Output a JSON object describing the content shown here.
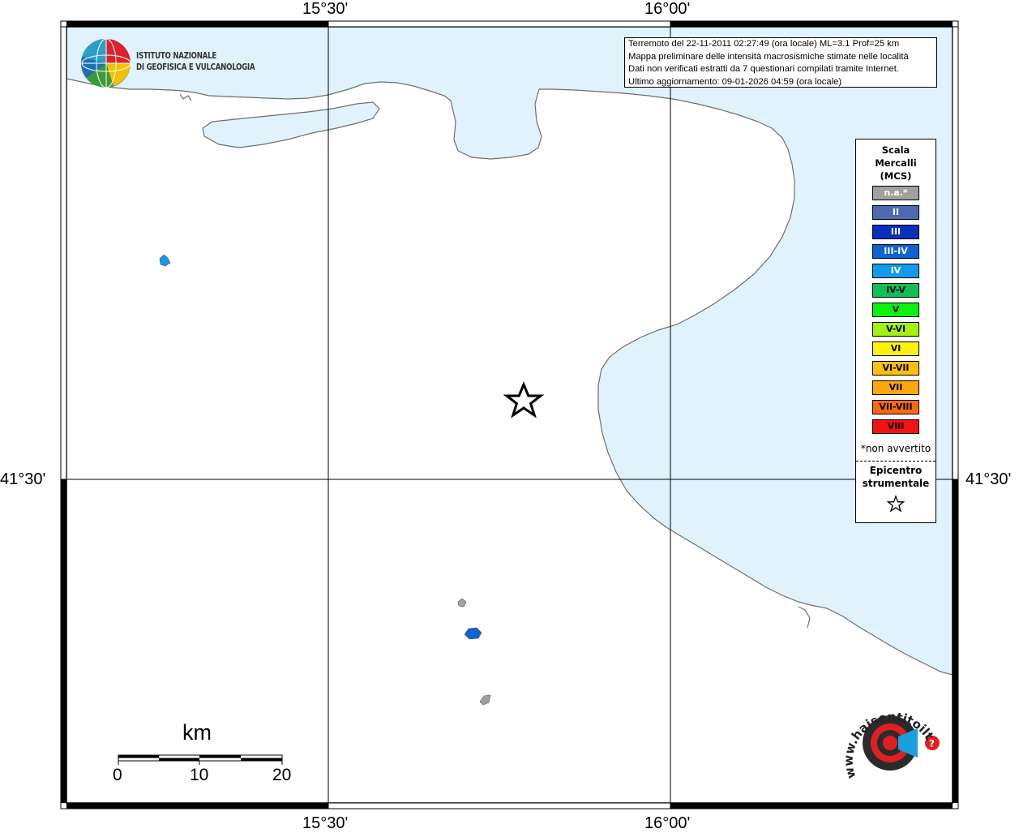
{
  "map": {
    "lon_labels": [
      "15°30'",
      "16°00'"
    ],
    "lat_labels": [
      "41°30'"
    ],
    "colors": {
      "sea": "#e0f2fc",
      "land": "#ffffff",
      "coast": "#6e6e6e",
      "frame": "#000000"
    }
  },
  "info_box": {
    "lines": [
      "Terremoto del 22-11-2011 02:27:49 (ora locale) ML=3.1 Prof=25 km",
      "Mappa preliminare delle intensità macrosismiche stimate nelle località",
      "Dati non verificati estratti da 7 questionari compilati tramite Internet.",
      "Ultimo aggiornamento: 09-01-2026 04:59 (ora locale)"
    ]
  },
  "logo": {
    "line1": "ISTITUTO NAZIONALE",
    "line2": "DI GEOFISICA E VULCANOLOGIA"
  },
  "legend": {
    "title1": "Scala",
    "title2": "Mercalli",
    "title3": "(MCS)",
    "items": [
      {
        "label": "n.a.*",
        "color": "#a0a0a0",
        "text": "#ffffff"
      },
      {
        "label": "II",
        "color": "#4f68b0",
        "text": "#ffffff"
      },
      {
        "label": "III",
        "color": "#0a2fbf",
        "text": "#ffffff"
      },
      {
        "label": "III-IV",
        "color": "#0f62d1",
        "text": "#ffffff"
      },
      {
        "label": "IV",
        "color": "#119be8",
        "text": "#ffffff"
      },
      {
        "label": "IV-V",
        "color": "#0fbf56",
        "text": "#000000"
      },
      {
        "label": "V",
        "color": "#0cf20c",
        "text": "#000000"
      },
      {
        "label": "V-VI",
        "color": "#a3f20f",
        "text": "#000000"
      },
      {
        "label": "VI",
        "color": "#fcf20a",
        "text": "#000000"
      },
      {
        "label": "VI-VII",
        "color": "#fcbf0a",
        "text": "#000000"
      },
      {
        "label": "VII",
        "color": "#fca80a",
        "text": "#000000"
      },
      {
        "label": "VII-VIII",
        "color": "#fc6a0a",
        "text": "#000000"
      },
      {
        "label": "VIII",
        "color": "#f21212",
        "text": "#000000"
      }
    ],
    "note": "*non avvertito",
    "epicenter1": "Epicentro",
    "epicenter2": "strumentale"
  },
  "scale_bar": {
    "title": "km",
    "ticks": [
      "0",
      "10",
      "20"
    ]
  },
  "localities": [
    {
      "intensity": "IV",
      "color": "#119be8"
    },
    {
      "intensity": "n.a.*",
      "color": "#a0a0a0"
    },
    {
      "intensity": "III-IV",
      "color": "#0f62d1"
    },
    {
      "intensity": "n.a.*",
      "color": "#a0a0a0"
    }
  ],
  "watermark": {
    "text": "www.haisentitoilterremoto.it"
  }
}
